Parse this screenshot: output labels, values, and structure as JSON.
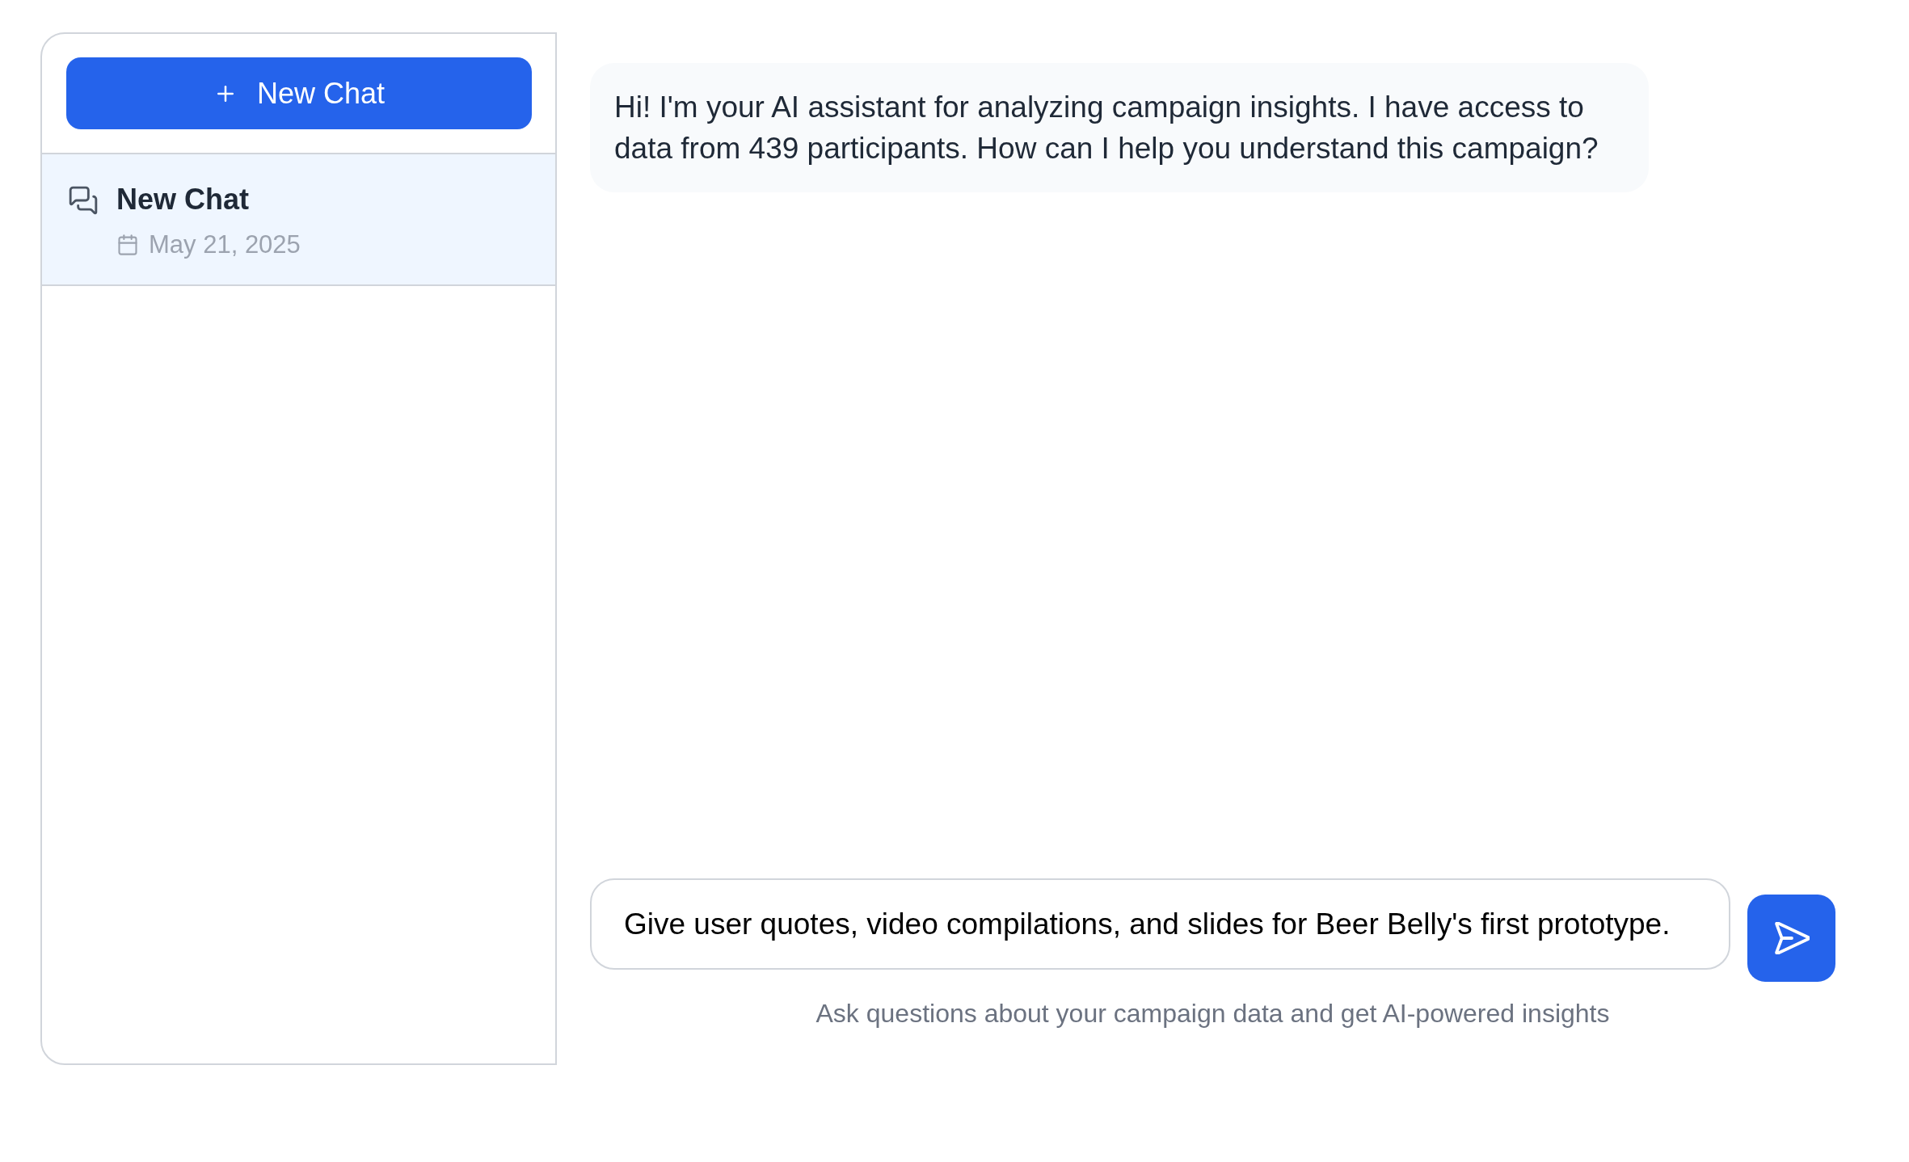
{
  "sidebar": {
    "new_chat_button": {
      "label": "New Chat"
    },
    "chats": [
      {
        "title": "New Chat",
        "date": "May 21, 2025",
        "selected": true
      }
    ]
  },
  "messages": [
    {
      "text": "Hi! I'm your AI assistant for analyzing campaign insights. I have access to data from 439 participants. How can I help you understand this campaign?"
    }
  ],
  "composer": {
    "value": "Give user quotes, video compilations, and slides for Beer Belly's first prototype.",
    "helper": "Ask questions about your campaign data and get AI-powered insights"
  }
}
